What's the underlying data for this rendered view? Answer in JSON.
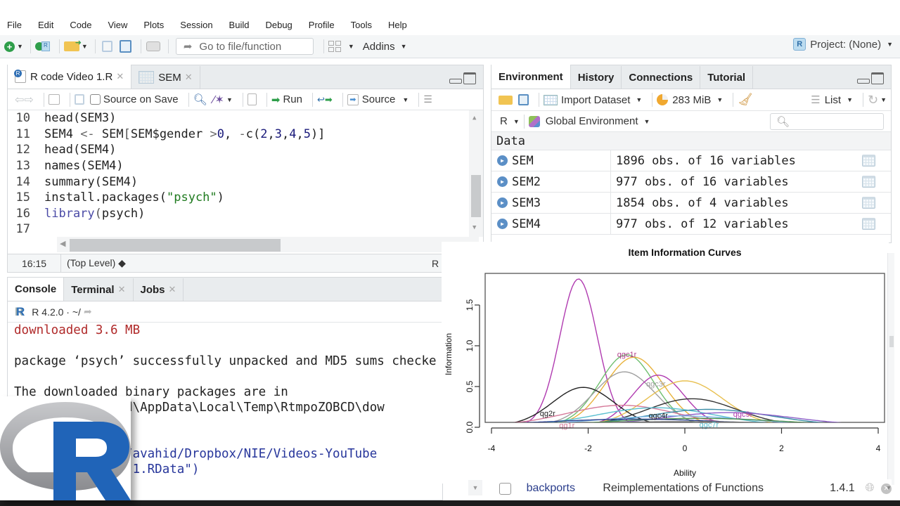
{
  "menubar": {
    "items": [
      "File",
      "Edit",
      "Code",
      "View",
      "Plots",
      "Session",
      "Build",
      "Debug",
      "Profile",
      "Tools",
      "Help"
    ]
  },
  "toolbar": {
    "goto_placeholder": "Go to file/function",
    "addins_label": "Addins",
    "project_label": "Project: (None)"
  },
  "source": {
    "tabs": [
      {
        "label": "R code Video 1.R",
        "icon": "r-file-icon"
      },
      {
        "label": "SEM",
        "icon": "table-icon"
      }
    ],
    "toolbar": {
      "source_on_save_label": "Source on Save",
      "run_label": "Run",
      "source_label": "Source"
    },
    "lines": [
      {
        "num": "10",
        "tokens": [
          {
            "t": "head(SEM3)",
            "c": "code"
          }
        ]
      },
      {
        "num": "11",
        "tokens": [
          {
            "t": "SEM4 ",
            "c": "code"
          },
          {
            "t": "<-",
            "c": "tok-op"
          },
          {
            "t": " SEM",
            "c": "code"
          },
          {
            "t": "[",
            "c": "tok-paren"
          },
          {
            "t": "SEM$gender ",
            "c": "code"
          },
          {
            "t": ">",
            "c": "tok-op"
          },
          {
            "t": "0",
            "c": "tok-num"
          },
          {
            "t": ", ",
            "c": "code"
          },
          {
            "t": "-",
            "c": "tok-op"
          },
          {
            "t": "c(",
            "c": "code"
          },
          {
            "t": "2",
            "c": "tok-num"
          },
          {
            "t": ",",
            "c": "code"
          },
          {
            "t": "3",
            "c": "tok-num"
          },
          {
            "t": ",",
            "c": "code"
          },
          {
            "t": "4",
            "c": "tok-num"
          },
          {
            "t": ",",
            "c": "code"
          },
          {
            "t": "5",
            "c": "tok-num"
          },
          {
            "t": ")]",
            "c": "code"
          }
        ]
      },
      {
        "num": "12",
        "tokens": [
          {
            "t": "head(SEM4)",
            "c": "code"
          }
        ]
      },
      {
        "num": "13",
        "tokens": [
          {
            "t": "names(SEM4)",
            "c": "code"
          }
        ]
      },
      {
        "num": "14",
        "tokens": [
          {
            "t": "summary(SEM4)",
            "c": "code"
          }
        ]
      },
      {
        "num": "15",
        "tokens": [
          {
            "t": "install.packages(",
            "c": "code"
          },
          {
            "t": "\"psych\"",
            "c": "tok-str"
          },
          {
            "t": ")",
            "c": "code"
          }
        ]
      },
      {
        "num": "16",
        "tokens": [
          {
            "t": "library",
            "c": "tok-fn"
          },
          {
            "t": "(",
            "c": "tok-paren"
          },
          {
            "t": "psych)",
            "c": "code"
          }
        ]
      },
      {
        "num": "17",
        "tokens": []
      }
    ],
    "status": {
      "cursor_pos": "16:15",
      "scope": "(Top Level) ◆",
      "file_type": "R"
    }
  },
  "console": {
    "tabs": [
      {
        "label": "Console",
        "closable": false
      },
      {
        "label": "Terminal",
        "closable": true
      },
      {
        "label": "Jobs",
        "closable": true
      }
    ],
    "r_version": "R 4.2.0 · ~/",
    "lines": [
      {
        "text": "downloaded 3.6 MB",
        "color": "red"
      },
      {
        "text": "",
        "color": "black"
      },
      {
        "text": "package ‘psych’ successfully unpacked and MD5 sums checke",
        "color": "black"
      },
      {
        "text": "",
        "color": "black"
      },
      {
        "text": "The downloaded binary packages are in",
        "color": "black"
      },
      {
        "text": "        s\\avahid\\AppData\\Local\\Temp\\RtmpoZOBCD\\dow",
        "color": "black"
      },
      {
        "text": "",
        "color": "black"
      },
      {
        "text": "        )",
        "color": "blue"
      },
      {
        "text": "        :/Users/avahid/Dropbox/NIE/Videos-YouTube",
        "color": "blue"
      },
      {
        "text": "        t Video 1.RData\")",
        "color": "blue"
      }
    ]
  },
  "environment": {
    "tabs": [
      "Environment",
      "History",
      "Connections",
      "Tutorial"
    ],
    "toolbar": {
      "import_label": "Import Dataset",
      "memory_label": "283 MiB",
      "view_label": "List"
    },
    "language": "R",
    "scope_label": "Global Environment",
    "search_placeholder": "",
    "section_label": "Data",
    "rows": [
      {
        "name": "SEM",
        "value": "1896 obs. of 16 variables"
      },
      {
        "name": "SEM2",
        "value": "977 obs. of 16 variables"
      },
      {
        "name": "SEM3",
        "value": "1854 obs. of 4 variables"
      },
      {
        "name": "SEM4",
        "value": "977 obs. of 12 variables"
      }
    ]
  },
  "packages": {
    "row": {
      "name": "backports",
      "description": "Reimplementations of Functions",
      "version": "1.4.1",
      "checked": false
    }
  },
  "chart_data": {
    "type": "line",
    "title": "Item Information Curves",
    "xlabel": "Ability",
    "ylabel": "Information",
    "xlim": [
      -4,
      4
    ],
    "ylim": [
      0,
      1.85
    ],
    "x_ticks": [
      "-4",
      "-2",
      "0",
      "2",
      "4"
    ],
    "y_ticks": [
      "0.0",
      "0.5",
      "1.0",
      "1.5"
    ],
    "grid": false,
    "x_range_plotted": [
      -3.8,
      3.8
    ],
    "series": [
      {
        "name": "peak-magenta",
        "color": "#b03bb0",
        "peak_x": -2.2,
        "peak_y": 1.8,
        "width": 0.55
      },
      {
        "name": "green",
        "color": "#6fbf6f",
        "peak_x": -1.2,
        "peak_y": 0.87,
        "width": 0.8
      },
      {
        "name": "orange",
        "color": "#e8b23c",
        "peak_x": -1.05,
        "peak_y": 0.84,
        "width": 0.85
      },
      {
        "name": "gray",
        "color": "#a0a0a0",
        "peak_x": -1.25,
        "peak_y": 0.66,
        "width": 0.9
      },
      {
        "name": "magenta2",
        "color": "#b03bb0",
        "peak_x": -0.55,
        "peak_y": 0.62,
        "width": 0.75
      },
      {
        "name": "yellow2",
        "color": "#e8c050",
        "peak_x": 0.0,
        "peak_y": 0.55,
        "width": 1.1
      },
      {
        "name": "black1",
        "color": "#222222",
        "peak_x": -2.1,
        "peak_y": 0.47,
        "width": 0.9
      },
      {
        "name": "black2",
        "color": "#333333",
        "peak_x": 0.15,
        "peak_y": 0.33,
        "width": 1.3
      },
      {
        "name": "pink",
        "color": "#d67a9a",
        "peak_x": -1.3,
        "peak_y": 0.25,
        "width": 1.6
      },
      {
        "name": "cyan",
        "color": "#5bc0d0",
        "peak_x": -0.6,
        "peak_y": 0.22,
        "width": 1.7
      },
      {
        "name": "teal",
        "color": "#3c8ea8",
        "peak_x": 0.5,
        "peak_y": 0.2,
        "width": 1.8
      },
      {
        "name": "purple",
        "color": "#8c5ec8",
        "peak_x": 0.9,
        "peak_y": 0.16,
        "width": 1.9
      },
      {
        "name": "lightblue",
        "color": "#7fb8e8",
        "peak_x": -0.2,
        "peak_y": 0.12,
        "width": 2.2
      },
      {
        "name": "darkgreen",
        "color": "#4d8f4d",
        "peak_x": 0.3,
        "peak_y": 0.09,
        "width": 2.4
      },
      {
        "name": "navy",
        "color": "#2b3e8c",
        "peak_x": -1.0,
        "peak_y": 0.08,
        "width": 2.6
      },
      {
        "name": "flat-gray",
        "color": "#777777",
        "peak_x": 0.0,
        "peak_y": 0.05,
        "width": 3.0
      }
    ],
    "labels": [
      {
        "text": "qgc1r",
        "x": -1.4,
        "y": 0.86,
        "color": "#b03b8a"
      },
      {
        "text": "qgc3r",
        "x": -0.8,
        "y": 0.5,
        "color": "#a0a0a0"
      },
      {
        "text": "qg2r",
        "x": -3.0,
        "y": 0.14,
        "color": "#222222"
      },
      {
        "text": "qgc4r",
        "x": -0.75,
        "y": 0.11,
        "color": "#222222"
      },
      {
        "text": "qgc9r",
        "x": 1.0,
        "y": 0.13,
        "color": "#b03bb0"
      },
      {
        "text": "qgc7r",
        "x": 0.3,
        "y": 0.0,
        "color": "#5bc0d0"
      },
      {
        "text": "qg1r",
        "x": -2.6,
        "y": -0.01,
        "color": "#d67a9a"
      }
    ]
  }
}
